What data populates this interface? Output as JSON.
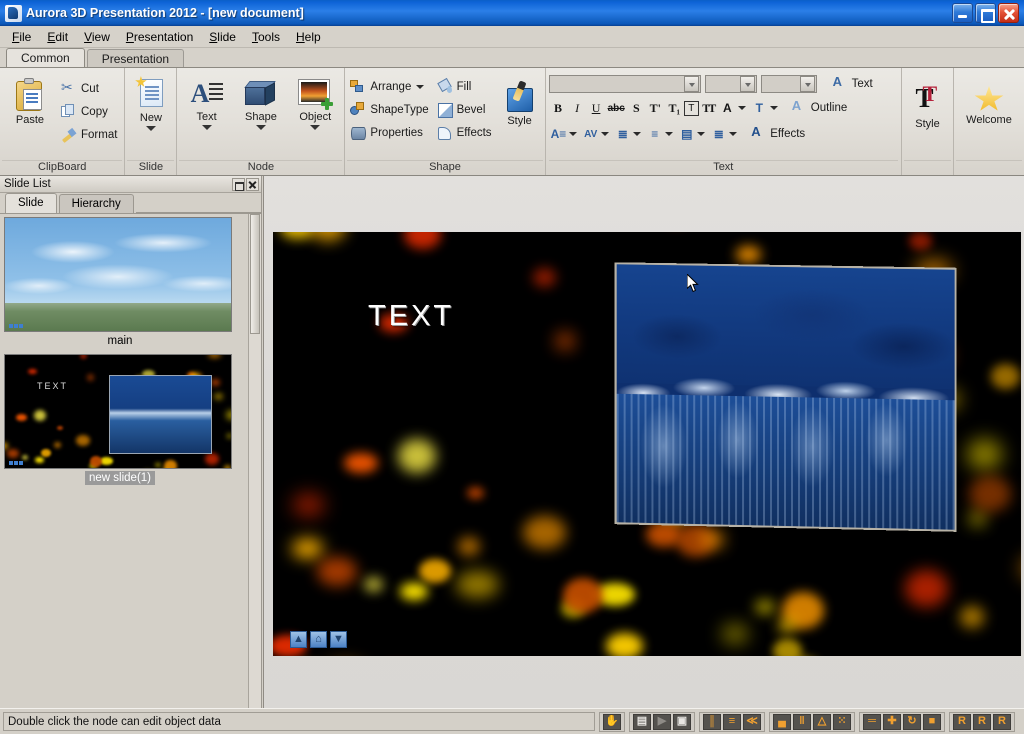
{
  "window": {
    "title": "Aurora 3D Presentation 2012 - [new document]",
    "minimize_label": "Minimize",
    "maximize_label": "Restore",
    "close_label": "Close"
  },
  "menubar": {
    "items": [
      {
        "label": "File",
        "accel": "F"
      },
      {
        "label": "Edit",
        "accel": "E"
      },
      {
        "label": "View",
        "accel": "V"
      },
      {
        "label": "Presentation",
        "accel": "P"
      },
      {
        "label": "Slide",
        "accel": "S"
      },
      {
        "label": "Tools",
        "accel": "T"
      },
      {
        "label": "Help",
        "accel": "H"
      }
    ]
  },
  "ribbon": {
    "tabs": [
      {
        "label": "Common",
        "active": true
      },
      {
        "label": "Presentation",
        "active": false
      }
    ],
    "groups": {
      "clipboard": {
        "label": "ClipBoard",
        "paste": "Paste",
        "cut": "Cut",
        "copy": "Copy",
        "format": "Format"
      },
      "slide": {
        "label": "Slide",
        "new": "New"
      },
      "node": {
        "label": "Node",
        "text": "Text",
        "shape": "Shape",
        "object": "Object"
      },
      "shape": {
        "label": "Shape",
        "arrange": "Arrange",
        "shapetype": "ShapeType",
        "properties": "Properties",
        "fill": "Fill",
        "bevel": "Bevel",
        "effects": "Effects",
        "style": "Style"
      },
      "text": {
        "label": "Text",
        "font_family_value": "",
        "font_size_value": "",
        "font_extra_value": "",
        "bold": "B",
        "italic": "I",
        "underline": "U",
        "strikethrough": "abc",
        "shadow": "S",
        "superscript": "T'",
        "subscript": "T₁",
        "boxed": "T",
        "double": "TT",
        "arch": "A",
        "text": "Text",
        "outline": "Outline",
        "fx": "Effects",
        "style": "Style"
      },
      "welcome": {
        "label": "Welcome"
      }
    }
  },
  "slide_list": {
    "title": "Slide List",
    "tabs": [
      {
        "label": "Slide",
        "active": true
      },
      {
        "label": "Hierarchy",
        "active": false
      }
    ],
    "slides": [
      {
        "caption": "main",
        "selected": false
      },
      {
        "caption": "new slide(1)",
        "selected": true
      }
    ]
  },
  "canvas": {
    "stage_text": "TEXT",
    "nav": [
      {
        "name": "move-up",
        "glyph": "▲"
      },
      {
        "name": "home",
        "glyph": "⌂"
      },
      {
        "name": "move-down",
        "glyph": "▼"
      }
    ]
  },
  "statusbar": {
    "message": "Double click the node can edit object data",
    "groups": [
      {
        "name": "hand-tool",
        "buttons": [
          {
            "name": "hand-tool",
            "glyph": "✋",
            "disabled": false
          }
        ]
      },
      {
        "name": "playback",
        "buttons": [
          {
            "name": "export",
            "glyph": "▤",
            "disabled": false
          },
          {
            "name": "play",
            "glyph": "▶",
            "disabled": true
          },
          {
            "name": "preview",
            "glyph": "▣",
            "disabled": false
          }
        ]
      },
      {
        "name": "align-tools",
        "buttons": [
          {
            "name": "align-vertical",
            "glyph": "║",
            "disabled": false
          },
          {
            "name": "align-left",
            "glyph": "≡",
            "disabled": false
          },
          {
            "name": "align-converge",
            "glyph": "≪",
            "disabled": false
          }
        ]
      },
      {
        "name": "distribute-tools",
        "buttons": [
          {
            "name": "distribute-bottom",
            "glyph": "▄",
            "disabled": false
          },
          {
            "name": "distribute-columns",
            "glyph": "‖",
            "disabled": false
          },
          {
            "name": "distribute-cone",
            "glyph": "△",
            "disabled": false
          },
          {
            "name": "scatter",
            "glyph": "⁙",
            "disabled": false
          }
        ]
      },
      {
        "name": "layer-tools",
        "buttons": [
          {
            "name": "layer-flat",
            "glyph": "═",
            "disabled": false
          },
          {
            "name": "layer-add",
            "glyph": "✚",
            "disabled": false
          },
          {
            "name": "layer-rotate",
            "glyph": "↻",
            "disabled": false
          },
          {
            "name": "layer-fill",
            "glyph": "■",
            "disabled": false
          }
        ]
      },
      {
        "name": "render-tools",
        "buttons": [
          {
            "name": "render-add",
            "glyph": "R",
            "disabled": false
          },
          {
            "name": "render-edit",
            "glyph": "R",
            "disabled": false
          },
          {
            "name": "render-apply",
            "glyph": "R",
            "disabled": false
          }
        ]
      }
    ]
  },
  "colors": {
    "titlebar_blue": "#0d63d6",
    "chrome_gray": "#d4d0c8",
    "ribbon_gray": "#e3e0da",
    "stage_black": "#000000",
    "forest_blue": "#16448f",
    "accent_orange": "#f0a030",
    "selection_gray": "#9a9a9a"
  }
}
